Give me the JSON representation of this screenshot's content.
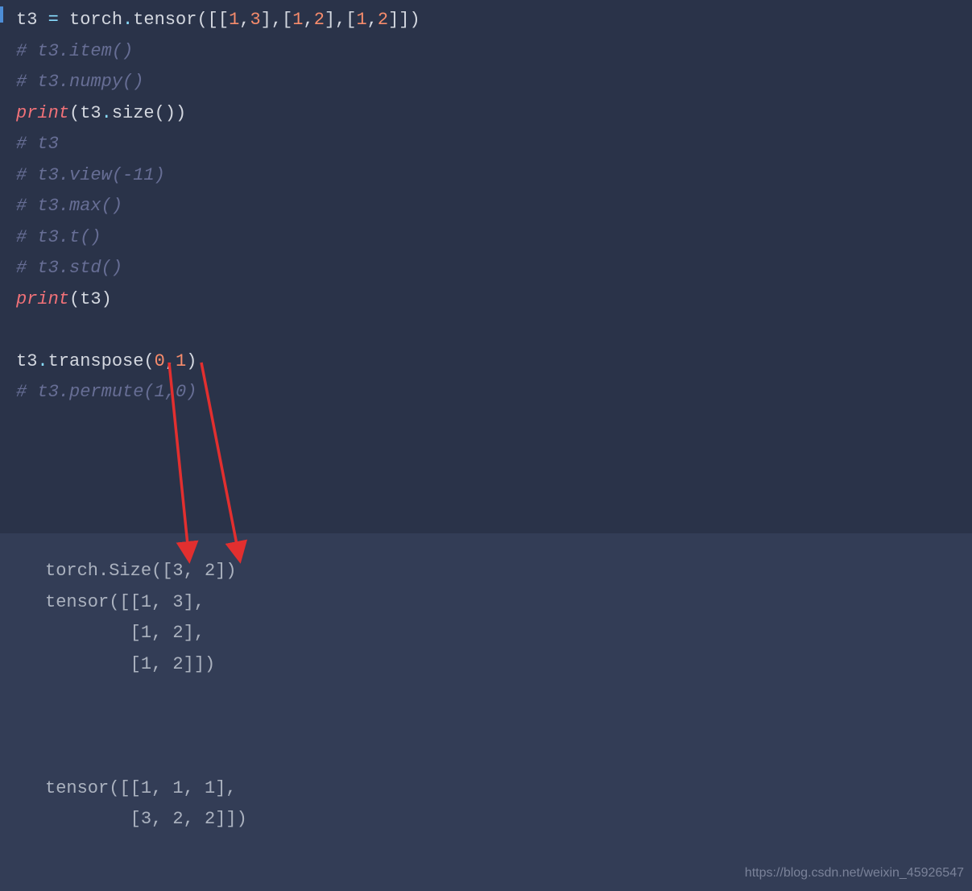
{
  "code": {
    "line1_p1": "t3 ",
    "line1_op": "=",
    "line1_p2": " torch",
    "line1_dot1": ".",
    "line1_p3": "tensor([[",
    "line1_n1": "1",
    "line1_c1": ",",
    "line1_n2": "3",
    "line1_c2": "],[",
    "line1_n3": "1",
    "line1_c3": ",",
    "line1_n4": "2",
    "line1_c4": "],[",
    "line1_n5": "1",
    "line1_c5": ",",
    "line1_n6": "2",
    "line1_c6": "]])",
    "line2": "# t3.item()",
    "line3": "# t3.numpy()",
    "line4_func": "print",
    "line4_p1": "(t3",
    "line4_dot": ".",
    "line4_p2": "size())",
    "line5": "# t3",
    "line6": "# t3.view(-11)",
    "line7": "# t3.max()",
    "line8": "# t3.t()",
    "line9": "# t3.std()",
    "line10_func": "print",
    "line10_p1": "(t3)",
    "line11": "",
    "line12_p1": "t3",
    "line12_dot": ".",
    "line12_p2": "transpose(",
    "line12_n1": "0",
    "line12_c1": ",",
    "line12_n2": "1",
    "line12_c2": ")",
    "line13": "# t3.permute(1,0)"
  },
  "output": {
    "line1": "torch.Size([3, 2])",
    "line2": "tensor([[1, 3],",
    "line3": "        [1, 2],",
    "line4": "        [1, 2]])",
    "line5": "",
    "line6": "",
    "line7": "",
    "line8": "tensor([[1, 1, 1],",
    "line9": "        [3, 2, 2]])"
  },
  "watermark": "https://blog.csdn.net/weixin_45926547"
}
